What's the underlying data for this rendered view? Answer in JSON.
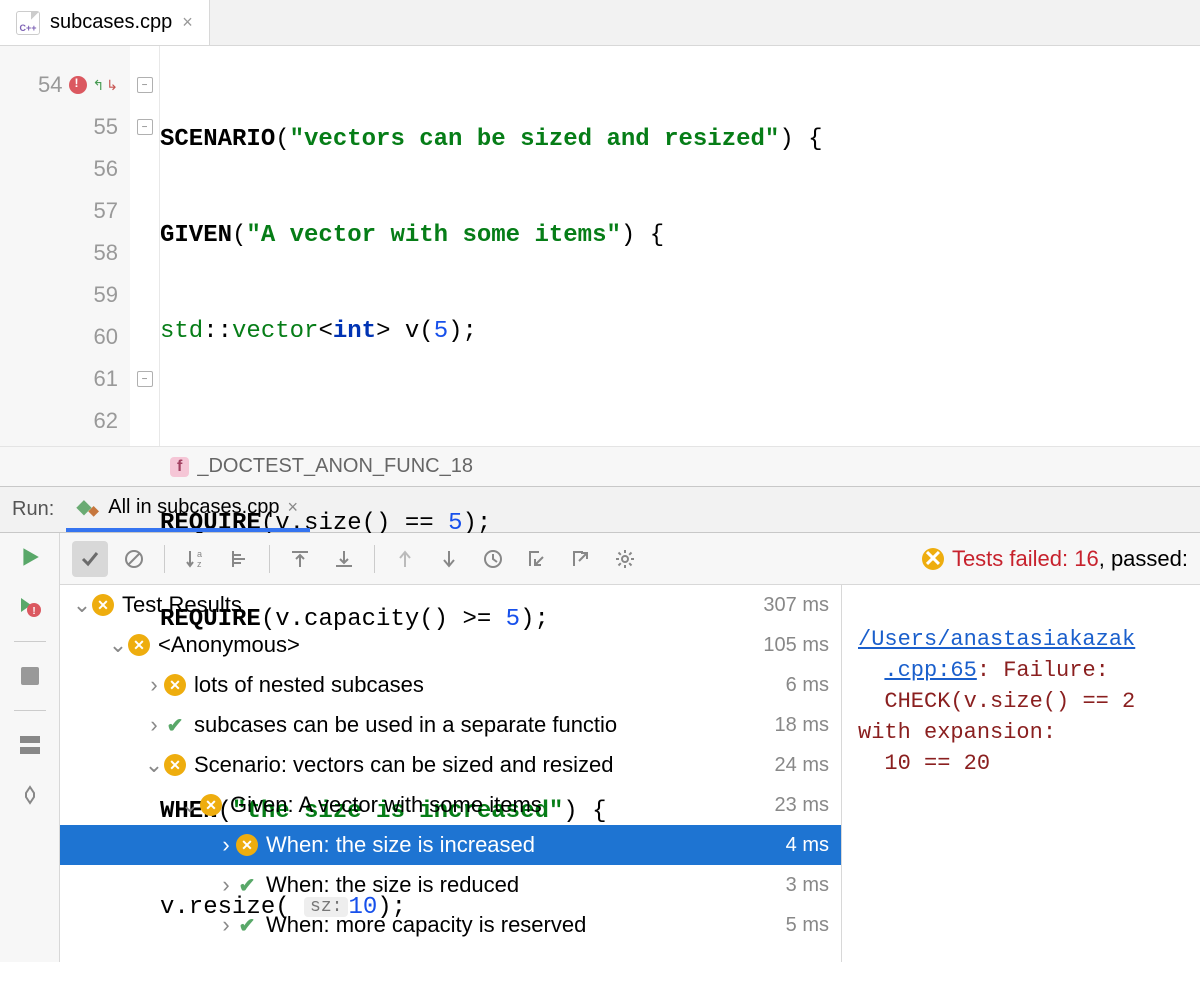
{
  "tab": {
    "filename": "subcases.cpp"
  },
  "editor": {
    "lines": [
      {
        "n": 54,
        "breakpoint": true,
        "fold": true
      },
      {
        "n": 55,
        "fold": true
      },
      {
        "n": 56
      },
      {
        "n": 57
      },
      {
        "n": 58
      },
      {
        "n": 59
      },
      {
        "n": 60
      },
      {
        "n": 61,
        "fold": true
      },
      {
        "n": 62
      }
    ],
    "code": {
      "l54_kw": "SCENARIO",
      "l54_str": "\"vectors can be sized and resized\"",
      "l55_kw": "GIVEN",
      "l55_str": "\"A vector with some items\"",
      "l56_std": "std",
      "l56_vec": "vector",
      "l56_int": "int",
      "l56_var": " v(",
      "l56_num": "5",
      "l58_kw": "REQUIRE",
      "l58_body": "(v.size() == ",
      "l58_num": "5",
      "l59_kw": "REQUIRE",
      "l59_body": "(v.capacity() >= ",
      "l59_num": "5",
      "l61_kw": "WHEN",
      "l61_str": "\"the size is increased\"",
      "l62_body": "v.resize( ",
      "l62_hint": "sz:",
      "l62_num": "10"
    }
  },
  "breadcrumb": {
    "badge": "f",
    "name": "_DOCTEST_ANON_FUNC_18"
  },
  "run": {
    "label": "Run:",
    "tab_name": "All in subcases.cpp",
    "status_failed_label": "Tests failed:",
    "status_failed_count": "16",
    "status_passed_label": ", passed:"
  },
  "tree": [
    {
      "depth": 0,
      "caret": "v",
      "status": "fail",
      "name": "Test Results",
      "time": "307 ms"
    },
    {
      "depth": 1,
      "caret": "v",
      "status": "fail",
      "name": "<Anonymous>",
      "time": "105 ms"
    },
    {
      "depth": 2,
      "caret": ">",
      "status": "fail",
      "name": "lots of nested subcases",
      "time": "6 ms"
    },
    {
      "depth": 2,
      "caret": ">",
      "status": "pass",
      "name": "subcases can be used in a separate functio",
      "time": "18 ms"
    },
    {
      "depth": 2,
      "caret": "v",
      "status": "fail",
      "name": "Scenario: vectors can be sized and resized",
      "time": "24 ms"
    },
    {
      "depth": 3,
      "caret": "v",
      "status": "fail",
      "name": "Given: A vector with some items",
      "time": "23 ms"
    },
    {
      "depth": 4,
      "caret": ">",
      "status": "fail",
      "name": "When: the size is increased",
      "time": "4 ms",
      "selected": true
    },
    {
      "depth": 4,
      "caret": ">",
      "status": "pass",
      "name": "When: the size is reduced",
      "time": "3 ms"
    },
    {
      "depth": 4,
      "caret": ">",
      "status": "pass",
      "name": "When: more capacity is reserved",
      "time": "5 ms"
    }
  ],
  "console": {
    "link": "/Users/anastasiakazak",
    "loc": ".cpp:65",
    "fail_label": ": Failure:",
    "check": "CHECK(v.size() == 2",
    "expansion_label": "with expansion:",
    "expansion": "10 == 20"
  }
}
